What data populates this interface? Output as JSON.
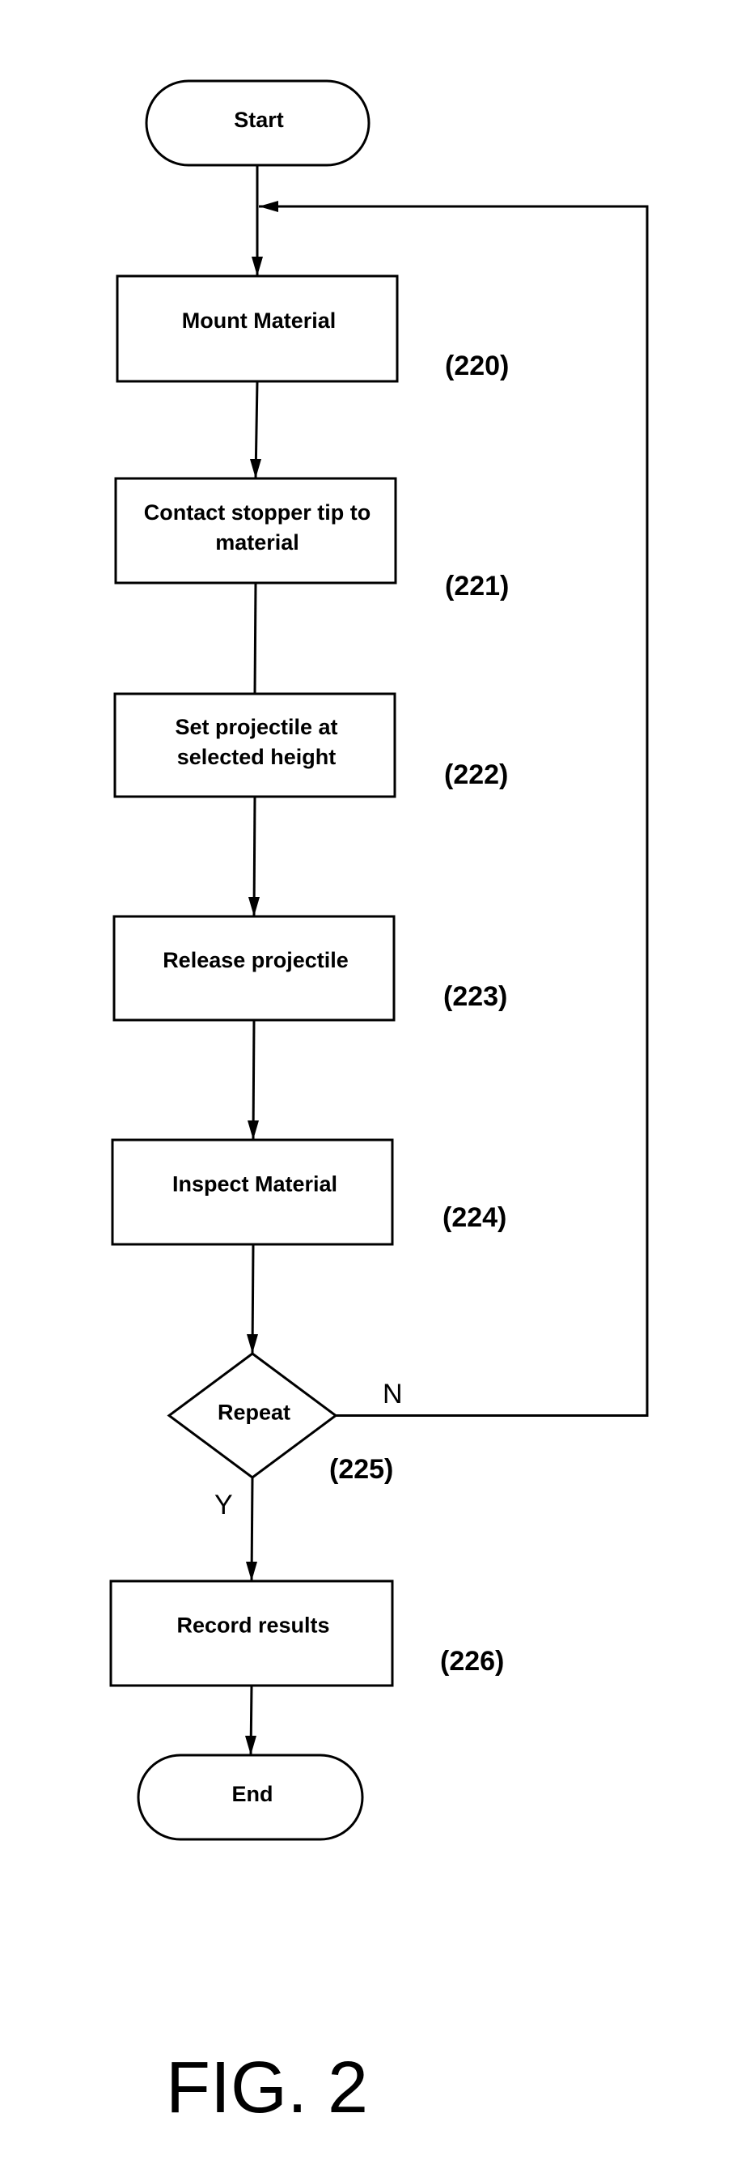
{
  "figure": {
    "caption": "FIG. 2"
  },
  "nodes": [
    {
      "id": "start",
      "type": "terminator",
      "lines": [
        "Start"
      ],
      "ref": ""
    },
    {
      "id": "mount",
      "type": "process",
      "lines": [
        "Mount Material"
      ],
      "ref": "(220)"
    },
    {
      "id": "contact",
      "type": "process",
      "lines": [
        "Contact stopper tip to",
        "material"
      ],
      "ref": "(221)"
    },
    {
      "id": "set",
      "type": "process",
      "lines": [
        "Set projectile at",
        "selected height"
      ],
      "ref": "(222)"
    },
    {
      "id": "release",
      "type": "process",
      "lines": [
        "Release projectile"
      ],
      "ref": "(223)"
    },
    {
      "id": "inspect",
      "type": "process",
      "lines": [
        "Inspect Material"
      ],
      "ref": "(224)"
    },
    {
      "id": "repeat",
      "type": "decision",
      "lines": [
        "Repeat"
      ],
      "ref": "(225)"
    },
    {
      "id": "record",
      "type": "process",
      "lines": [
        "Record results"
      ],
      "ref": "(226)"
    },
    {
      "id": "end",
      "type": "terminator",
      "lines": [
        "End"
      ],
      "ref": ""
    }
  ],
  "edges": [
    {
      "from": "start",
      "to": "mount",
      "arrow": true,
      "label": ""
    },
    {
      "from": "mount",
      "to": "contact",
      "arrow": true,
      "label": ""
    },
    {
      "from": "contact",
      "to": "set",
      "arrow": false,
      "label": ""
    },
    {
      "from": "set",
      "to": "release",
      "arrow": true,
      "label": ""
    },
    {
      "from": "release",
      "to": "inspect",
      "arrow": true,
      "label": ""
    },
    {
      "from": "inspect",
      "to": "repeat",
      "arrow": true,
      "label": ""
    },
    {
      "from": "repeat",
      "to": "record",
      "arrow": true,
      "label": "Y"
    },
    {
      "from": "repeat",
      "to": "mount",
      "arrow": true,
      "label": "N",
      "route": "loop-right-to-top"
    },
    {
      "from": "record",
      "to": "end",
      "arrow": true,
      "label": ""
    }
  ]
}
